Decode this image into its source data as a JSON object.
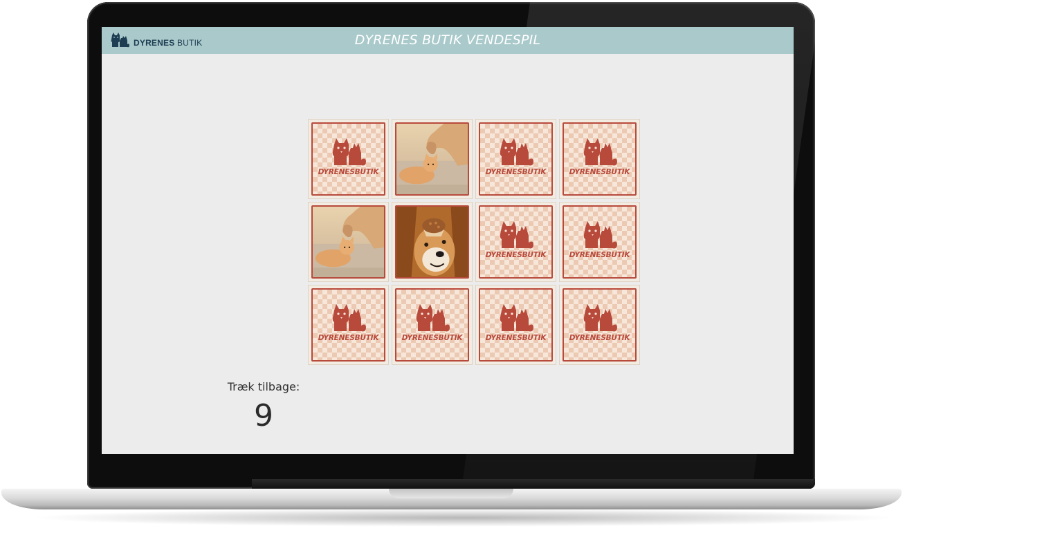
{
  "app": {
    "title": "DYRENES BUTIK VENDESPIL",
    "logo_bold": "DYRENES",
    "logo_light": "BUTIK",
    "logo_icon": "cat-fox-logo-icon"
  },
  "colors": {
    "topbar": "#a9c9cb",
    "screen_background": "#ececec",
    "card_accent": "#b84a3c",
    "card_checker_light": "#f7e7da",
    "card_checker_dark": "#ecc9b2"
  },
  "board": {
    "columns": 4,
    "rows": 3,
    "card_back_brand": "DYRENESBUTIK",
    "card_back_icon": "cat-fox-icon",
    "cards": [
      {
        "state": "face-down"
      },
      {
        "state": "face-up",
        "image": "dog-and-cat-photo"
      },
      {
        "state": "face-down"
      },
      {
        "state": "face-down"
      },
      {
        "state": "face-up",
        "image": "dog-and-cat-photo"
      },
      {
        "state": "face-up",
        "image": "dog-with-cupcake-photo"
      },
      {
        "state": "face-down"
      },
      {
        "state": "face-down"
      },
      {
        "state": "face-down"
      },
      {
        "state": "face-down"
      },
      {
        "state": "face-down"
      },
      {
        "state": "face-down"
      }
    ]
  },
  "counter": {
    "label": "Træk tilbage:",
    "value": "9"
  }
}
